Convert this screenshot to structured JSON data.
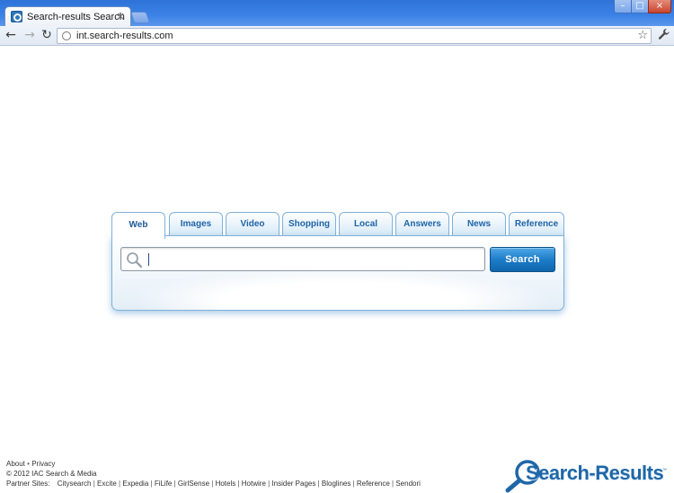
{
  "browser": {
    "tab_title": "Search-results Search",
    "tab_close": "×",
    "url": "int.search-results.com",
    "window_buttons": {
      "minimize": "–",
      "maximize": "□",
      "close": "×"
    },
    "nav": {
      "back": "←",
      "forward": "→",
      "reload": "↻"
    },
    "icons": {
      "bookmark": "☆",
      "wrench": "🔧"
    }
  },
  "search": {
    "tabs": [
      "Web",
      "Images",
      "Video",
      "Shopping",
      "Local",
      "Answers",
      "News",
      "Reference"
    ],
    "active_tab": "Web",
    "query": "",
    "button_label": "Search",
    "colors": {
      "accent": "#1e7dc8",
      "tab_text": "#1e64a8",
      "border": "#7fb1d9"
    }
  },
  "footer": {
    "about": "About",
    "bullet": "•",
    "privacy": "Privacy",
    "copyright": "© 2012 IAC Search & Media",
    "partner_label": "Partner Sites:",
    "partners": [
      "Citysearch",
      "Excite",
      "Expedia",
      "FiLife",
      "GirlSense",
      "Hotels",
      "Hotwire",
      "Insider Pages",
      "Bloglines",
      "Reference",
      "Sendori"
    ]
  },
  "brand": {
    "logo_text": "Search-Results",
    "trademark": "™"
  }
}
